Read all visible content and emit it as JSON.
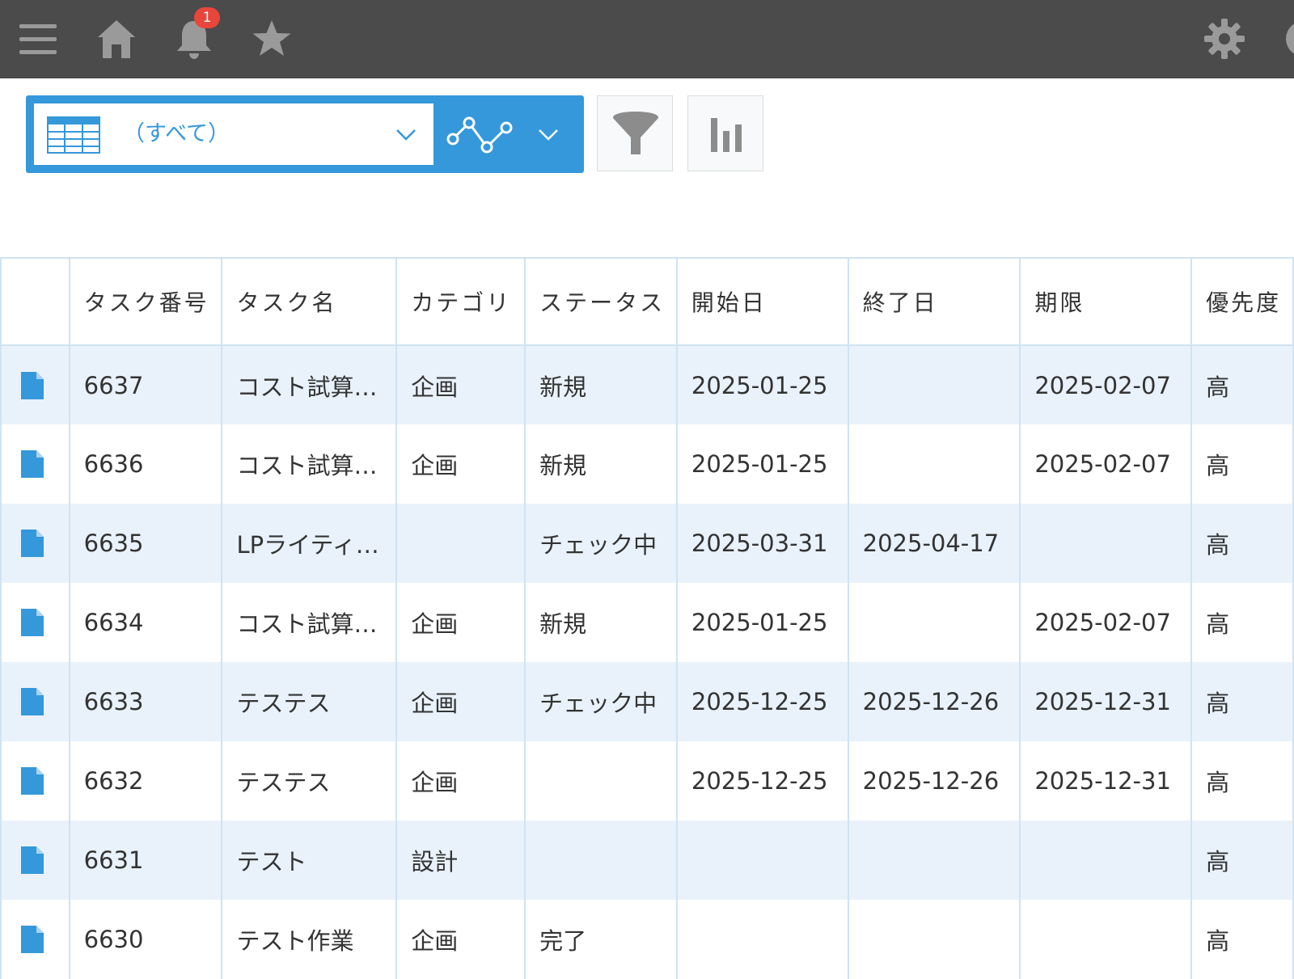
{
  "header": {
    "icons": [
      "menu-icon",
      "home-icon",
      "bell-icon",
      "star-icon",
      "gear-icon"
    ],
    "notification_count": "1",
    "background_color": "#4b4b4b"
  },
  "toolbar": {
    "view_name": "（すべて）",
    "accent_color": "#3498db"
  },
  "table": {
    "columns": [
      "タスク番号",
      "タスク名",
      "カテゴリ",
      "ステータス",
      "開始日",
      "終了日",
      "期限",
      "優先度"
    ],
    "rows": [
      {
        "id": "6637",
        "name": "コスト試算…",
        "category": "企画",
        "status": "新規",
        "start": "2025-01-25",
        "end": "",
        "due": "2025-02-07",
        "priority": "高"
      },
      {
        "id": "6636",
        "name": "コスト試算…",
        "category": "企画",
        "status": "新規",
        "start": "2025-01-25",
        "end": "",
        "due": "2025-02-07",
        "priority": "高"
      },
      {
        "id": "6635",
        "name": "LPライティ…",
        "category": "",
        "status": "チェック中",
        "start": "2025-03-31",
        "end": "2025-04-17",
        "due": "",
        "priority": "高"
      },
      {
        "id": "6634",
        "name": "コスト試算…",
        "category": "企画",
        "status": "新規",
        "start": "2025-01-25",
        "end": "",
        "due": "2025-02-07",
        "priority": "高"
      },
      {
        "id": "6633",
        "name": "テステス",
        "category": "企画",
        "status": "チェック中",
        "start": "2025-12-25",
        "end": "2025-12-26",
        "due": "2025-12-31",
        "priority": "高"
      },
      {
        "id": "6632",
        "name": "テステス",
        "category": "企画",
        "status": "",
        "start": "2025-12-25",
        "end": "2025-12-26",
        "due": "2025-12-31",
        "priority": "高"
      },
      {
        "id": "6631",
        "name": "テスト",
        "category": "設計",
        "status": "",
        "start": "",
        "end": "",
        "due": "",
        "priority": "高"
      },
      {
        "id": "6630",
        "name": "テスト作業",
        "category": "企画",
        "status": "完了",
        "start": "",
        "end": "",
        "due": "",
        "priority": "高"
      }
    ],
    "row_icon": "document-icon",
    "stripe_color": "#e9f2fb",
    "border_color": "#cfe3f3"
  }
}
